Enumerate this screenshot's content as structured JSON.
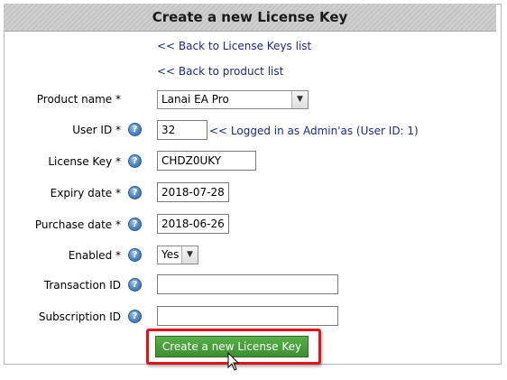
{
  "form": {
    "title": "Create a new License Key",
    "links": {
      "back_to_keys": "<< Back to License Keys list",
      "back_to_product": "<< Back to product list"
    },
    "fields": {
      "product_name": {
        "label": "Product name *",
        "value": "Lanai EA Pro"
      },
      "user_id": {
        "label": "User ID *",
        "value": "32",
        "note": "<< Logged in as Admin'as (User ID: 1)"
      },
      "license_key": {
        "label": "License Key *",
        "value": "CHDZ0UKY"
      },
      "expiry_date": {
        "label": "Expiry date *",
        "value": "2018-07-28"
      },
      "purchase_date": {
        "label": "Purchase date *",
        "value": "2018-06-26"
      },
      "enabled": {
        "label": "Enabled *",
        "value": "Yes"
      },
      "transaction_id": {
        "label": "Transaction ID",
        "value": ""
      },
      "subscription_id": {
        "label": "Subscription ID",
        "value": ""
      }
    },
    "help_glyph": "?",
    "submit_label": "Create a new License Key"
  },
  "colors": {
    "accent_button": "#4a9e3c",
    "highlight": "#e01414",
    "link": "#1a2a8a"
  },
  "icons": {
    "help": "question-mark-help-icon",
    "dropdown": "chevron-down-icon",
    "cursor": "mouse-pointer-icon"
  }
}
